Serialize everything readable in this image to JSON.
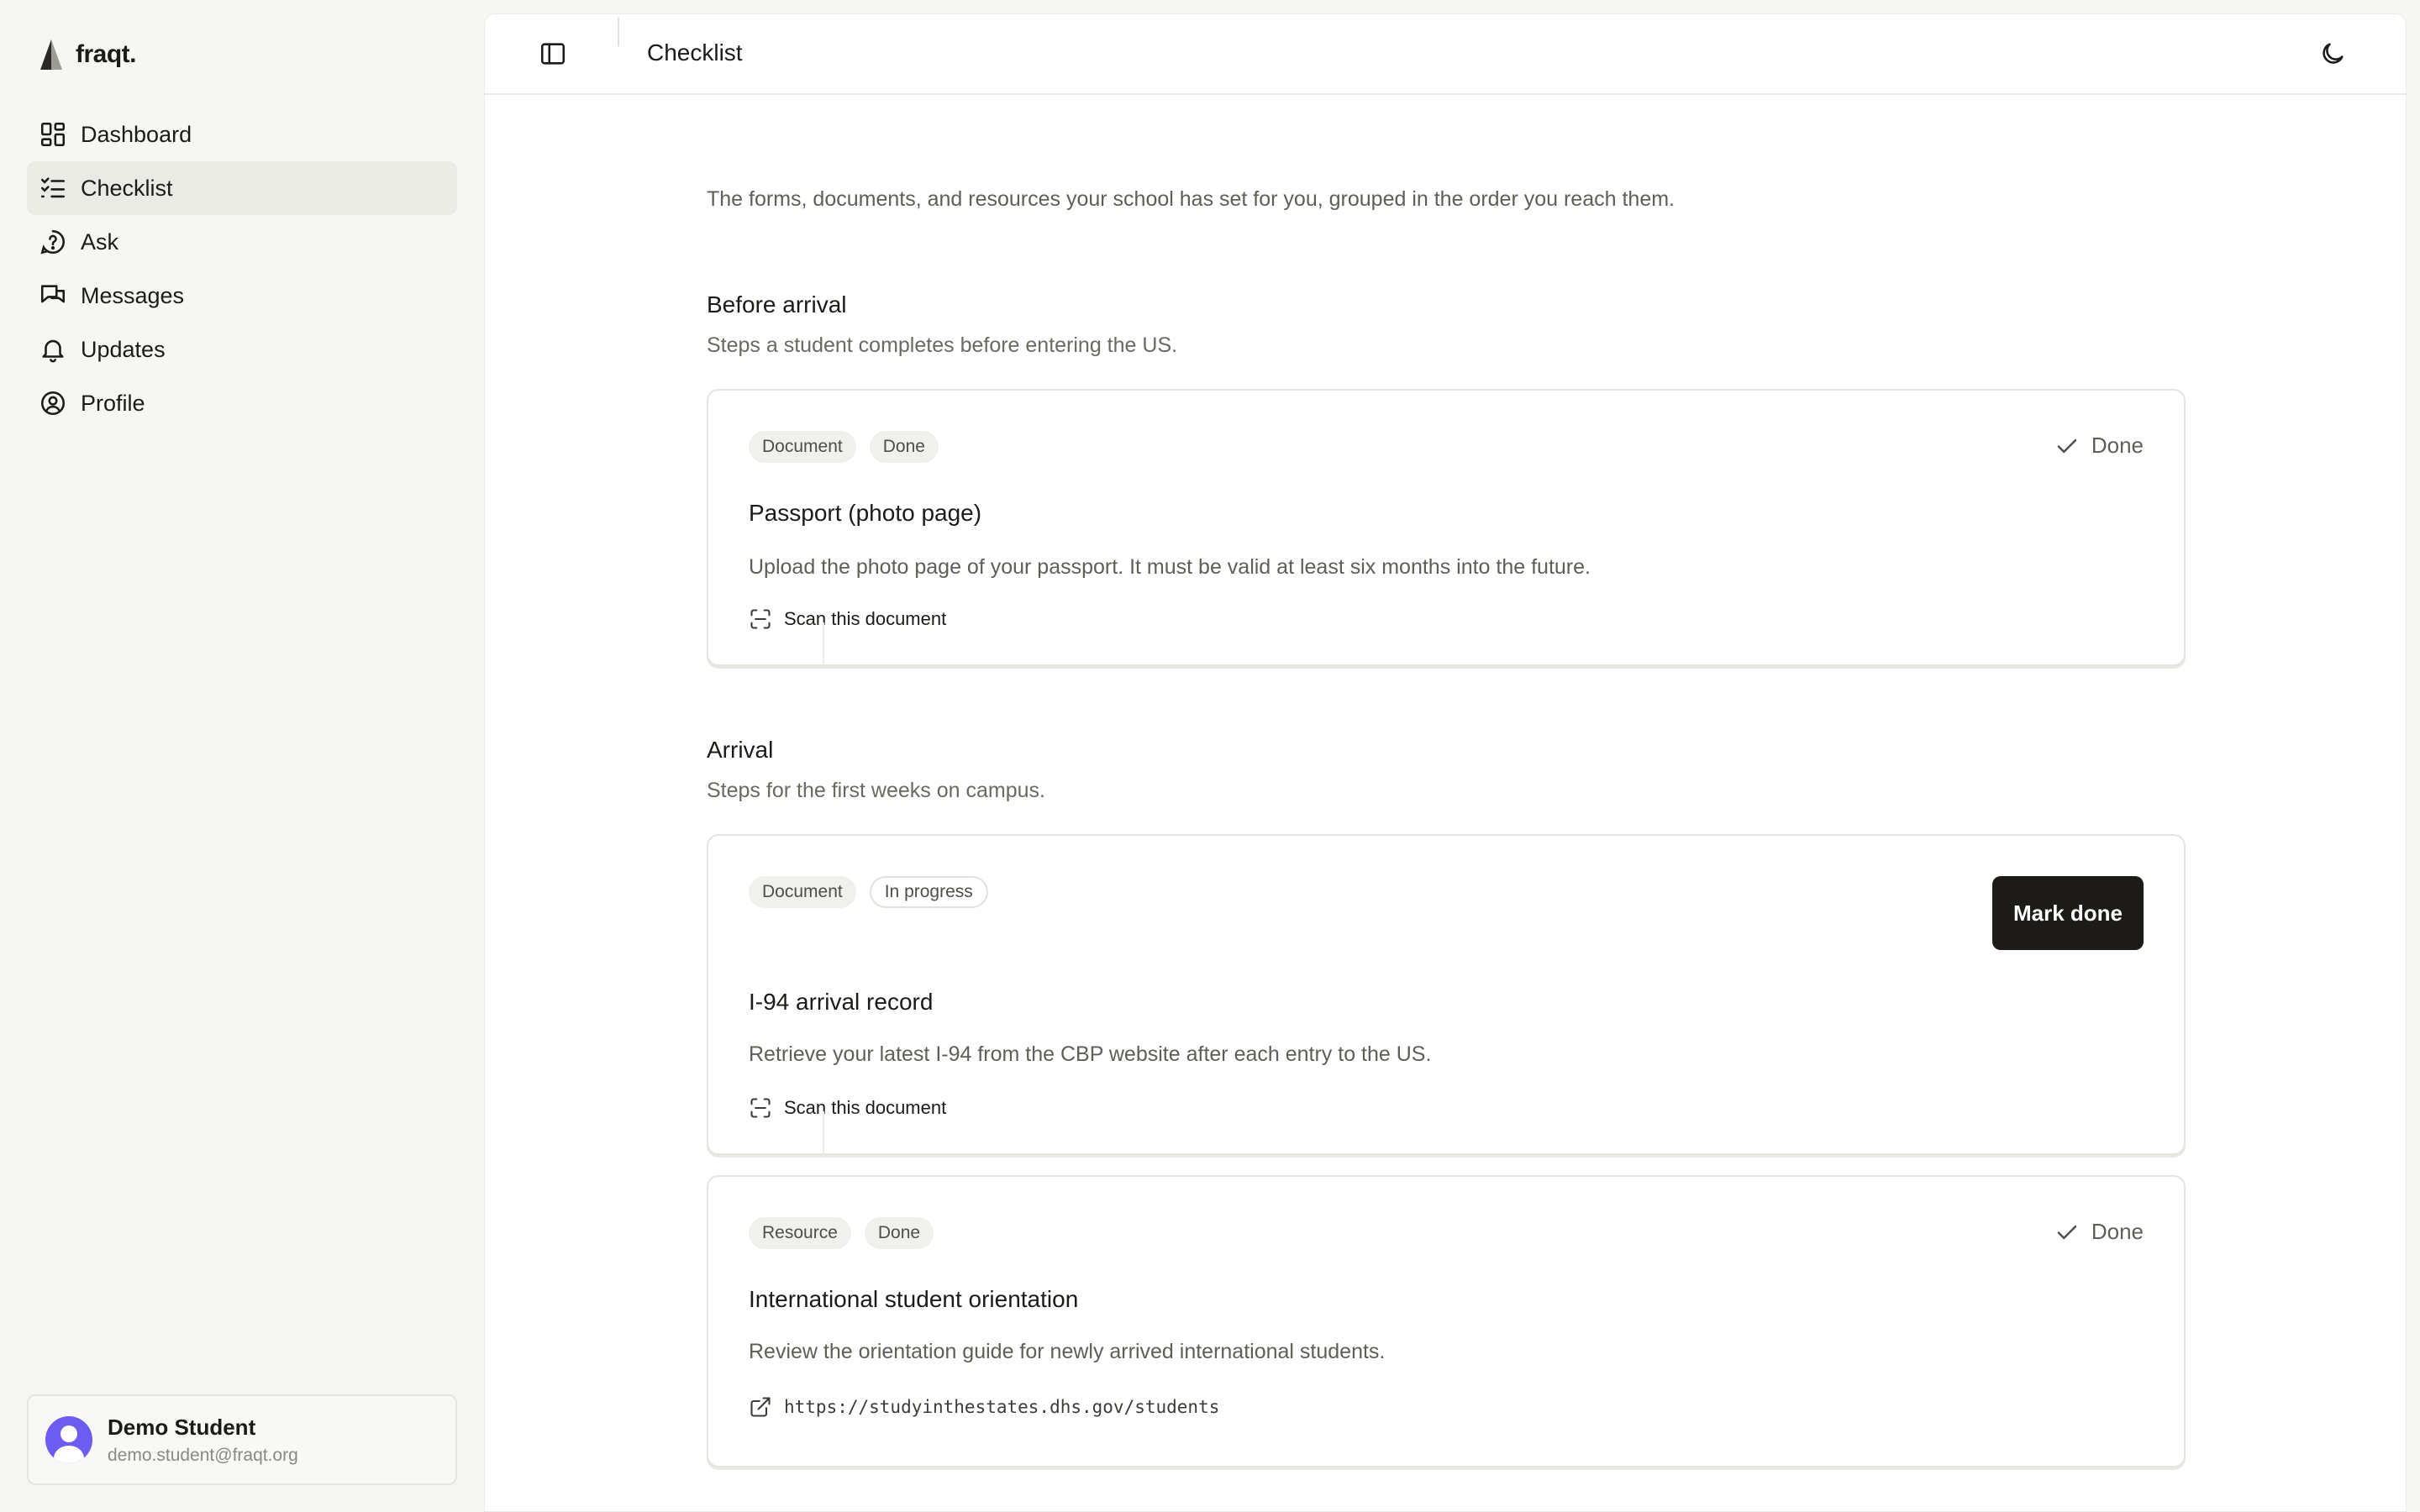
{
  "app": {
    "logo_text": "fraqt."
  },
  "sidebar": {
    "items": [
      {
        "label": "Dashboard",
        "icon": "dashboard-icon"
      },
      {
        "label": "Checklist",
        "icon": "checklist-icon",
        "active": true
      },
      {
        "label": "Ask",
        "icon": "help-circle-icon"
      },
      {
        "label": "Messages",
        "icon": "messages-icon"
      },
      {
        "label": "Updates",
        "icon": "bell-icon"
      },
      {
        "label": "Profile",
        "icon": "user-circle-icon"
      }
    ],
    "user": {
      "name": "Demo Student",
      "email": "demo.student@fraqt.org"
    }
  },
  "header": {
    "title": "Checklist"
  },
  "main": {
    "intro": "The forms, documents, and resources your school has set for you, grouped in the order you reach them.",
    "sections": [
      {
        "title": "Before arrival",
        "subtitle": "Steps a student completes before entering the US.",
        "cards": [
          {
            "chips": [
              "Document",
              "Done"
            ],
            "title": "Passport (photo page)",
            "description": "Upload the photo page of your passport. It must be valid at least six months into the future.",
            "action": "Scan this document",
            "status": "Done"
          }
        ]
      },
      {
        "title": "Arrival",
        "subtitle": "Steps for the first weeks on campus.",
        "cards": [
          {
            "chips": [
              "Document",
              "In progress"
            ],
            "title": "I-94 arrival record",
            "description": "Retrieve your latest I-94 from the CBP website after each entry to the US.",
            "action": "Scan this document",
            "button": "Mark done"
          },
          {
            "chips": [
              "Resource",
              "Done"
            ],
            "title": "International student orientation",
            "description": "Review the orientation guide for newly arrived international students.",
            "link": "https://studyinthestates.dhs.gov/students",
            "status": "Done"
          }
        ]
      }
    ]
  },
  "colors": {
    "accent": "#1c1b17",
    "avatar": "#6d5cf0",
    "sidebar_bg": "#f6f6f3"
  }
}
